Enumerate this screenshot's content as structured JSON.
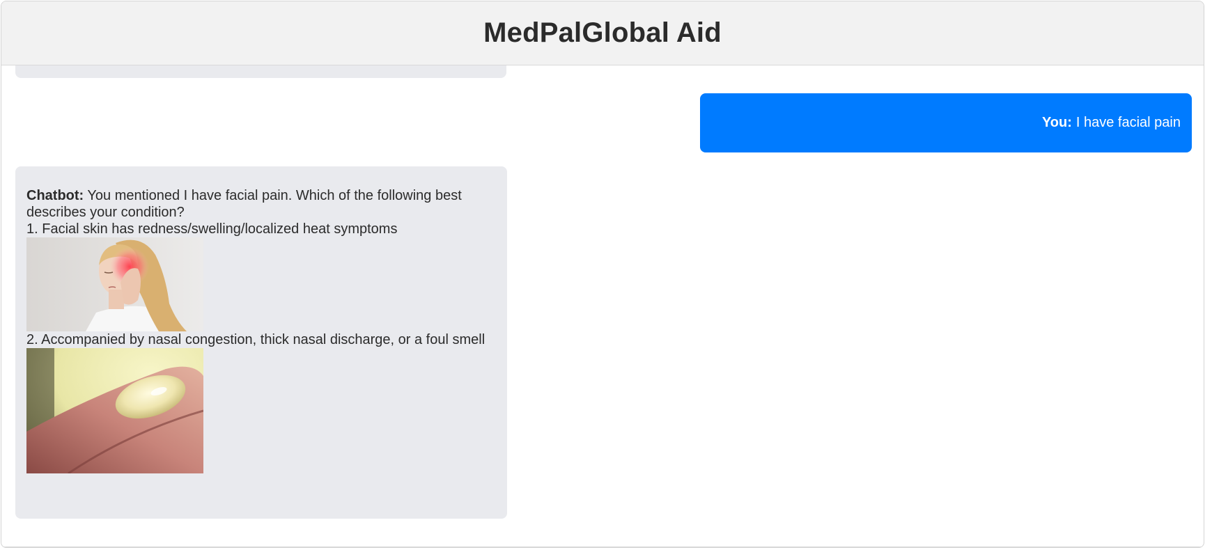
{
  "app": {
    "title": "MedPalGlobal Aid"
  },
  "messages": {
    "user": {
      "sender": "You:",
      "text": "I have facial pain"
    },
    "bot": {
      "sender": "Chatbot:",
      "intro": "You mentioned I have facial pain. Which of the following best describes your condition?",
      "option1": "1. Facial skin has redness/swelling/localized heat symptoms",
      "option2": "2. Accompanied by nasal congestion, thick nasal discharge, or a foul smell"
    }
  },
  "colors": {
    "user_bubble": "#007bff",
    "bot_bubble": "#e9eaee",
    "header_bg": "#f2f2f2"
  }
}
